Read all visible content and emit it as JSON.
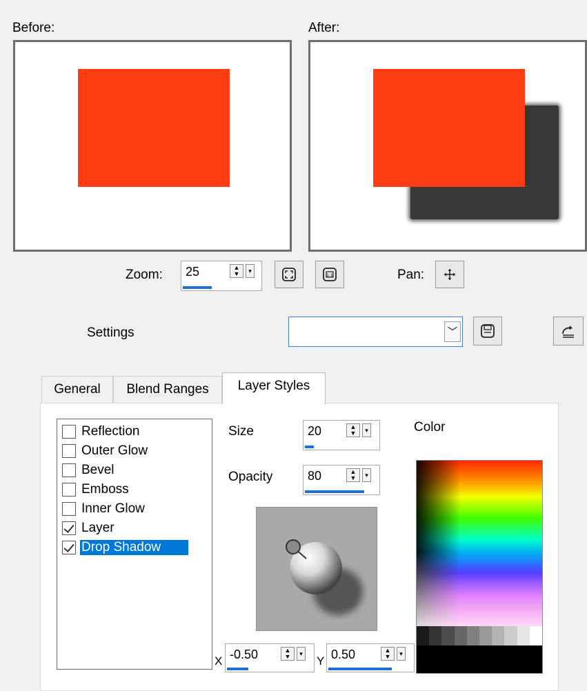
{
  "preview": {
    "before_label": "Before:",
    "after_label": "After:",
    "zoom_label": "Zoom:",
    "zoom_value": "25",
    "zoom_fill": 0.5,
    "pan_label": "Pan:"
  },
  "settings": {
    "label": "Settings",
    "preset_value": ""
  },
  "tabs": [
    {
      "label": "General"
    },
    {
      "label": "Blend Ranges"
    },
    {
      "label": "Layer Styles"
    }
  ],
  "active_tab": "Layer Styles",
  "styles": [
    {
      "label": "Reflection",
      "checked": false
    },
    {
      "label": "Outer Glow",
      "checked": false
    },
    {
      "label": "Bevel",
      "checked": false
    },
    {
      "label": "Emboss",
      "checked": false
    },
    {
      "label": "Inner Glow",
      "checked": false
    },
    {
      "label": "Layer",
      "checked": true
    },
    {
      "label": "Drop Shadow",
      "checked": true,
      "selected": true
    }
  ],
  "shadow": {
    "size_label": "Size",
    "size_value": "20",
    "size_fill": 0.12,
    "opacity_label": "Opacity",
    "opacity_value": "80",
    "opacity_fill": 0.8,
    "color_label": "Color",
    "x_label": "X",
    "x_value": "-0.50",
    "x_fill": 0.25,
    "y_label": "Y",
    "y_value": "0.50",
    "y_fill": 0.75
  },
  "colors": {
    "object": "#ff3c12",
    "shadow": "#383838",
    "selection": "#0078d7",
    "slider_fill": "#1e6ed6"
  },
  "icons": {
    "zoom_fit": "zoom-fit-icon",
    "zoom_actual": "zoom-actual-size-icon",
    "pan": "pan-move-icon",
    "save_preset": "save-icon",
    "reset": "reset-icon"
  }
}
